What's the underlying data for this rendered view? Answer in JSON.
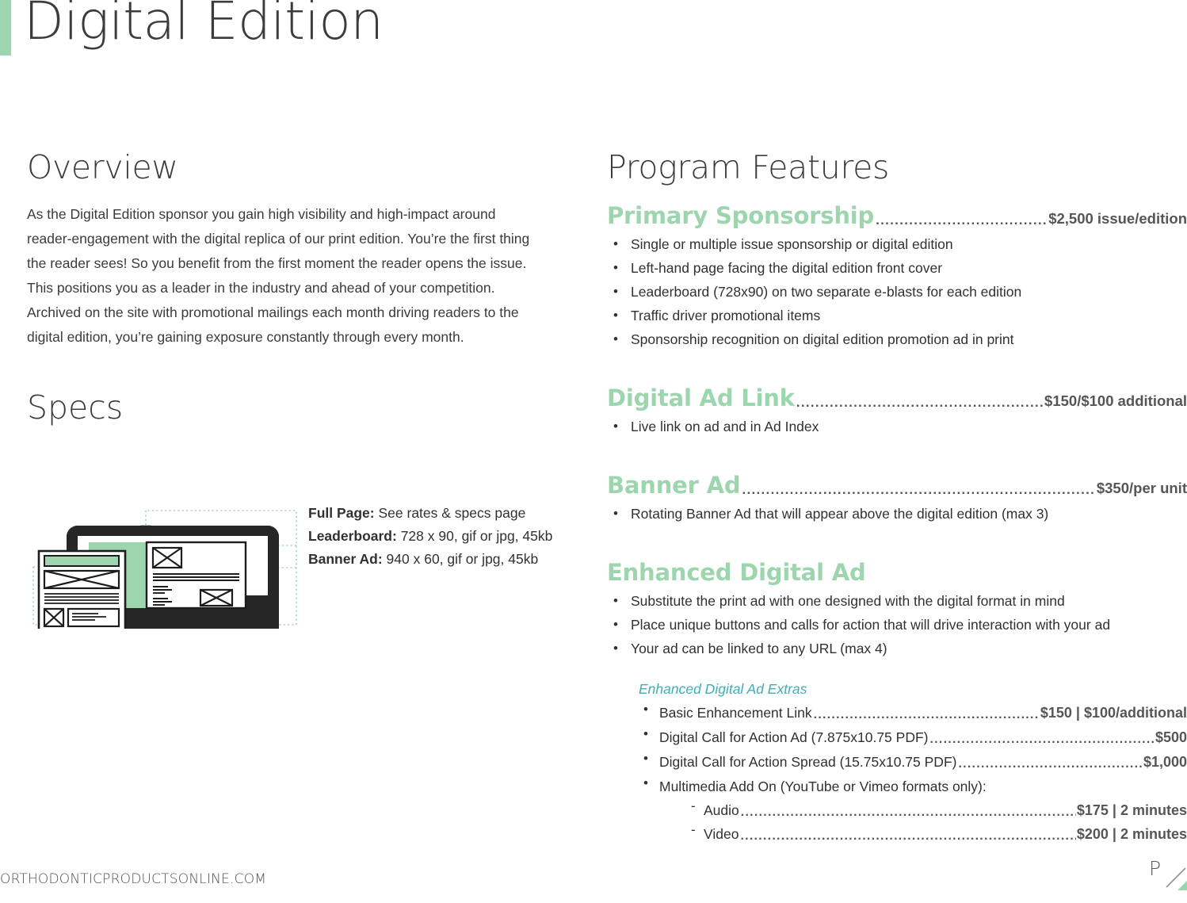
{
  "header": {
    "title": "Digital Edition",
    "accent_color": "#9dd6ae"
  },
  "colors": {
    "green": "#9dd6ae",
    "teal": "#3eaeb5",
    "dark": "#3b3c40",
    "price": "#55565a"
  },
  "left_column": {
    "overview_heading": "Overview",
    "overview_body": "As the Digital Edition sponsor you gain high visibility and high-impact around reader-engagement with the digital replica of our print edition. You’re the first thing the reader sees! So you benefit from the first moment the reader opens the issue. This positions you as a leader in the industry and ahead of your competition. Archived on the site with promotional mailings each month driving readers to the digital edition, you’re gaining exposure constantly through every month.",
    "specs_heading": "Specs",
    "specs": [
      {
        "label": "Full Page:",
        "value": "See rates & specs page"
      },
      {
        "label": "Leaderboard:",
        "value": "728 x 90, gif or jpg, 45kb"
      },
      {
        "label": "Banner Ad:",
        "value": "940 x 60, gif or jpg, 45kb"
      }
    ]
  },
  "right_column": {
    "heading": "Program Features",
    "features": [
      {
        "name": "Primary Sponsorship",
        "price": "$2,500 issue/edition",
        "bullets": [
          "Single or multiple issue sponsorship or digital edition",
          "Left-hand page facing the digital edition front cover",
          "Leaderboard (728x90) on two separate e-blasts for each edition",
          "Traffic driver promotional items",
          "Sponsorship recognition on digital edition promotion ad in print"
        ]
      },
      {
        "name": "Digital Ad Link",
        "price": "$150/$100 additional",
        "bullets": [
          "Live link on ad and in Ad Index"
        ]
      },
      {
        "name": "Banner Ad",
        "price": "$350/per unit",
        "bullets": [
          "Rotating Banner Ad that will appear above the digital edition (max 3)"
        ]
      },
      {
        "name": "Enhanced Digital Ad",
        "price": "",
        "bullets": [
          "Substitute the print ad with one designed with the digital format in mind",
          "Place unique buttons and calls for action that will drive interaction with your ad",
          "Your ad can be linked to any URL (max 4)"
        ]
      }
    ],
    "extras": {
      "title": "Enhanced Digital Ad Extras",
      "items": [
        {
          "name": "Basic Enhancement Link",
          "price": "$150 | $100/additional"
        },
        {
          "name": "Digital Call for Action Ad (7.875x10.75 PDF)",
          "price": "$500"
        },
        {
          "name": "Digital Call for Action Spread (15.75x10.75 PDF)",
          "price": "$1,000"
        }
      ],
      "multimedia_label": "Multimedia Add On (YouTube or Vimeo formats only):",
      "multimedia_items": [
        {
          "name": "Audio",
          "price": "$175 | 2 minutes"
        },
        {
          "name": "Video",
          "price": "$200 | 2 minutes"
        }
      ]
    }
  },
  "footer": {
    "site": "ORTHODONTICPRODUCTSONLINE.COM",
    "page_mark": "P"
  }
}
